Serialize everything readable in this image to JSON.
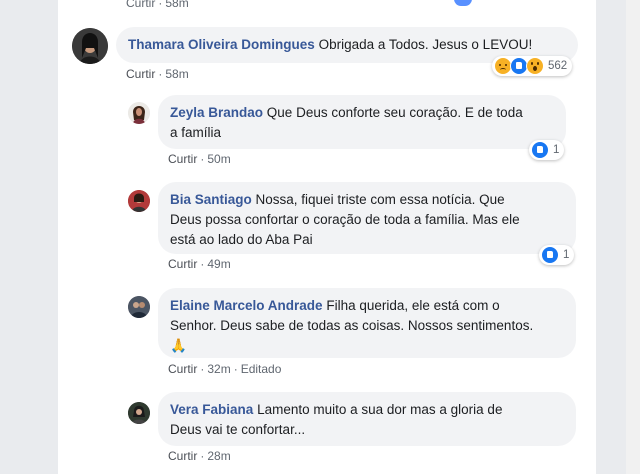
{
  "top": {
    "action": "Curtir",
    "time": "58m"
  },
  "comments": [
    {
      "author": "Thamara Oliveira Domingues",
      "text": "Obrigada a Todos. Jesus o LEVOU!",
      "action": "Curtir",
      "time": "58m",
      "reactions": {
        "icons": [
          "sad-icon",
          "like-icon",
          "wow-icon"
        ],
        "count": "562"
      }
    },
    {
      "author": "Zeyla Brandao",
      "text_line1": "Que Deus conforte seu coração. E de toda",
      "text_line2": "a família",
      "action": "Curtir",
      "time": "50m",
      "reactions": {
        "icons": [
          "like-icon"
        ],
        "count": "1"
      }
    },
    {
      "author": "Bia Santiago",
      "text_line1": "Nossa, fiquei triste com essa notícia. Que",
      "text_line2": "Deus possa confortar o coração de toda a família. Mas ele",
      "text_line3": "está ao lado do Aba Pai",
      "action": "Curtir",
      "time": "49m",
      "reactions": {
        "icons": [
          "like-icon"
        ],
        "count": "1"
      }
    },
    {
      "author": "Elaine Marcelo Andrade",
      "text_line1": "Filha querida, ele está com o",
      "text_line2": "Senhor. Deus sabe de todas as coisas. Nossos sentimentos.",
      "text_line3": "🙏",
      "action": "Curtir",
      "time": "32m",
      "edited": "Editado"
    },
    {
      "author": "Vera Fabiana",
      "text_line1": "Lamento muito a sua dor mas a gloria de",
      "text_line2": "Deus vai te confortar...",
      "action": "Curtir",
      "time": "28m"
    }
  ],
  "colors": {
    "author": "#385898",
    "bubble": "#f2f3f5",
    "like": "#1877f2",
    "emoji": "#f7b125"
  }
}
